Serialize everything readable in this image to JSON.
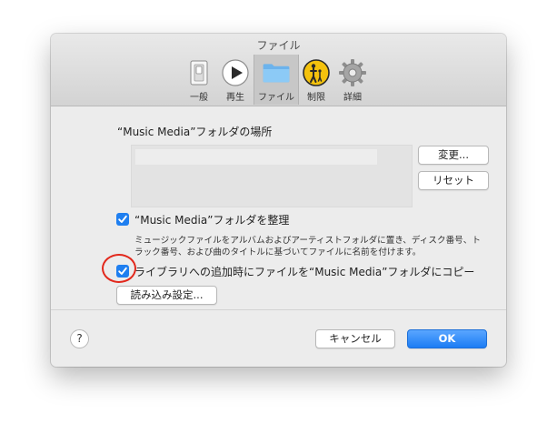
{
  "window": {
    "title": "ファイル"
  },
  "toolbar": {
    "items": [
      {
        "label": "一般",
        "icon": "switch-icon"
      },
      {
        "label": "再生",
        "icon": "play-icon"
      },
      {
        "label": "ファイル",
        "icon": "folder-icon"
      },
      {
        "label": "制限",
        "icon": "parental-control-icon"
      },
      {
        "label": "詳細",
        "icon": "gear-icon"
      }
    ],
    "selected": "ファイル"
  },
  "location": {
    "title": "“Music Media”フォルダの場所",
    "change_label": "変更...",
    "reset_label": "リセット"
  },
  "options": {
    "organize_label": "“Music Media”フォルダを整理",
    "organize_checked": true,
    "organize_desc": "ミュージックファイルをアルバムおよびアーティストフォルダに置き、ディスク番号、トラック番号、および曲のタイトルに基づいてファイルに名前を付けます。",
    "copy_label": "ライブラリへの追加時にファイルを“Music Media”フォルダにコピー",
    "copy_checked": true,
    "import_settings_label": "読み込み設定..."
  },
  "footer": {
    "help_label": "?",
    "cancel_label": "キャンセル",
    "ok_label": "OK"
  },
  "colors": {
    "accent": "#1f7ff0",
    "highlight_circle": "#e2281c"
  }
}
